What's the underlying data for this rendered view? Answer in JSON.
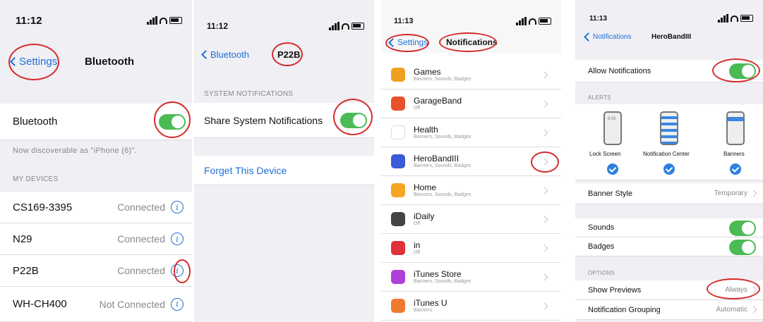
{
  "panel1": {
    "time": "11:12",
    "back": "Settings",
    "title": "Bluetooth",
    "bt_label": "Bluetooth",
    "discoverable": "Now discoverable as \"iPhone (6)\".",
    "my_devices": "MY DEVICES",
    "devices": [
      {
        "name": "CS169-3395",
        "status": "Connected"
      },
      {
        "name": "N29",
        "status": "Connected"
      },
      {
        "name": "P22B",
        "status": "Connected"
      },
      {
        "name": "WH-CH400",
        "status": "Not Connected"
      }
    ]
  },
  "panel2": {
    "time": "11:12",
    "back": "Bluetooth",
    "title": "P22B",
    "section": "SYSTEM NOTIFICATIONS",
    "share": "Share System Notifications",
    "forget": "Forget This Device"
  },
  "panel3": {
    "time": "11:13",
    "back": "Settings",
    "title": "Notifications",
    "apps": [
      {
        "name": "Games",
        "sub": "Banners, Sounds, Badges",
        "color": "#f0a020"
      },
      {
        "name": "GarageBand",
        "sub": "Off",
        "color": "#e8502a"
      },
      {
        "name": "Health",
        "sub": "Banners, Sounds, Badges",
        "color": "#ffffff"
      },
      {
        "name": "HeroBandIII",
        "sub": "Banners, Sounds, Badges",
        "color": "#3a5ad8"
      },
      {
        "name": "Home",
        "sub": "Banners, Sounds, Badges",
        "color": "#f5a623"
      },
      {
        "name": "iDaily",
        "sub": "Off",
        "color": "#444444"
      },
      {
        "name": "in",
        "sub": "Off",
        "color": "#e0303a"
      },
      {
        "name": "iTunes Store",
        "sub": "Banners, Sounds, Badges",
        "color": "#b040d8"
      },
      {
        "name": "iTunes U",
        "sub": "Banners",
        "color": "#f07a30"
      }
    ]
  },
  "panel4": {
    "time": "11:13",
    "back": "Notifications",
    "title": "HeroBandIII",
    "allow": "Allow Notifications",
    "alerts": "ALERTS",
    "lock_label": "Lock Screen",
    "center_label": "Notification Center",
    "banners_label": "Banners",
    "banner_style": "Banner Style",
    "banner_style_val": "Temporary",
    "sounds": "Sounds",
    "badges": "Badges",
    "options": "OPTIONS",
    "show_previews": "Show Previews",
    "show_previews_val": "Always",
    "grouping": "Notification Grouping",
    "grouping_val": "Automatic",
    "phone_time": "9:41"
  },
  "colors": {
    "accent": "#1f6fd6",
    "toggle": "#4cbb54",
    "annotation": "#d62b2b"
  }
}
